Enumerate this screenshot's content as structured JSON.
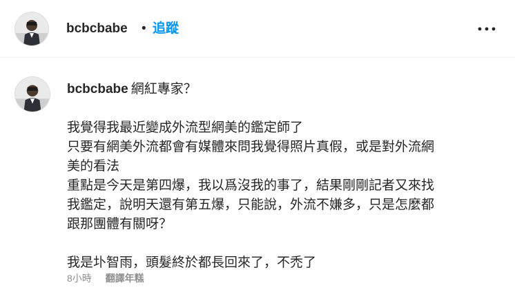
{
  "header": {
    "username": "bcbcbabe",
    "separator": "•",
    "follow_label": "追蹤",
    "more_icon": "more-horizontal-icon"
  },
  "comment": {
    "username": "bcbcbabe",
    "title": "網紅專家？",
    "lines": [
      "我覺得我最近變成外流型網美的鑑定師了",
      "只要有網美外流都會有媒體來問我覺得照片真假，或是對外流網",
      "美的看法",
      "重點是今天是第四爆，我以爲沒我的事了，結果剛剛記者又來找",
      "我鑑定，說明天還有第五爆，只能說，外流不嫌多，只是怎麼都",
      "跟那團體有關呀？",
      "",
      "我是圤智雨，頭髮終於都長回來了，不禿了"
    ],
    "time": "8小時",
    "translate_label": "翻譯年糕"
  },
  "colors": {
    "accent": "#0095f6",
    "text": "#262626",
    "muted": "#8e8e8e",
    "divider": "#efefef"
  }
}
